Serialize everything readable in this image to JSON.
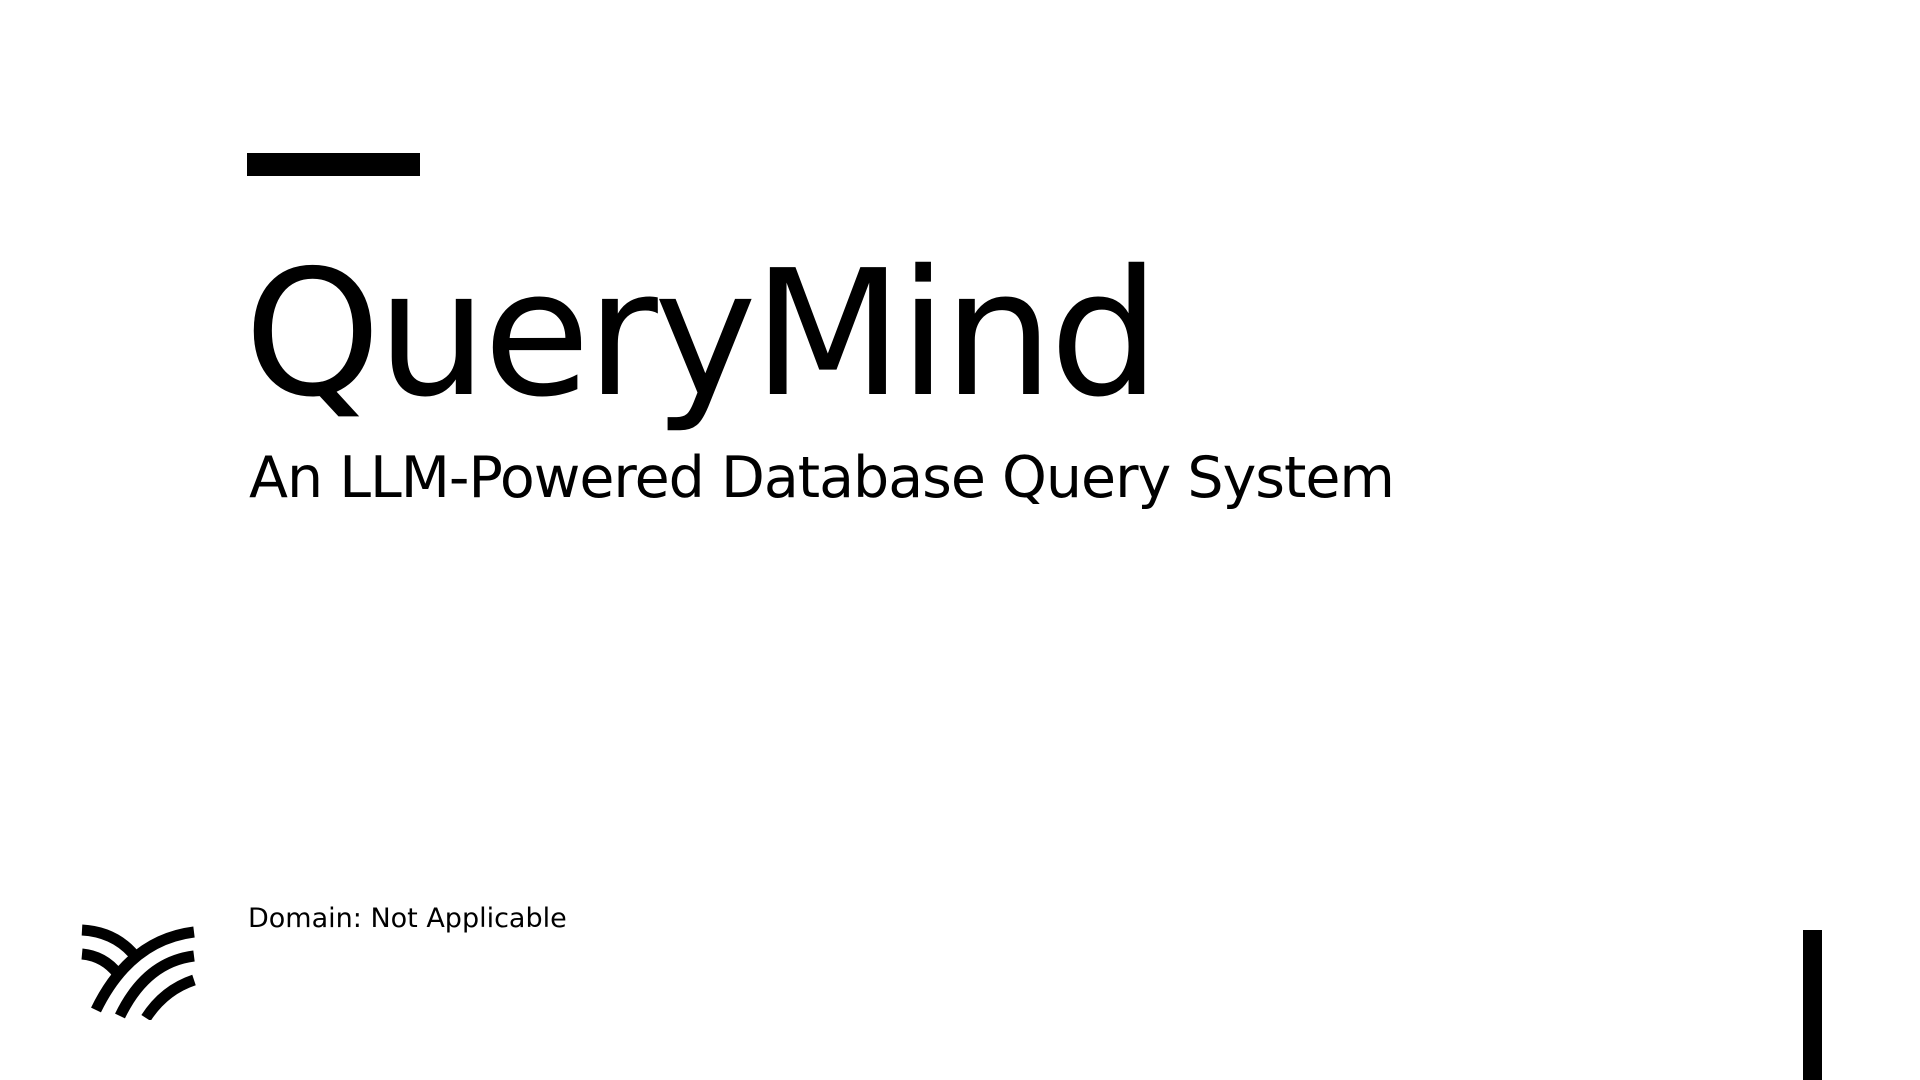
{
  "slide": {
    "title": "QueryMind",
    "subtitle": "An LLM-Powered Database Query System",
    "domain_label": "Domain: Not Applicable"
  },
  "icons": {
    "logo": "bird-wing-logo-icon"
  },
  "colors": {
    "background": "#ffffff",
    "foreground": "#000000"
  }
}
